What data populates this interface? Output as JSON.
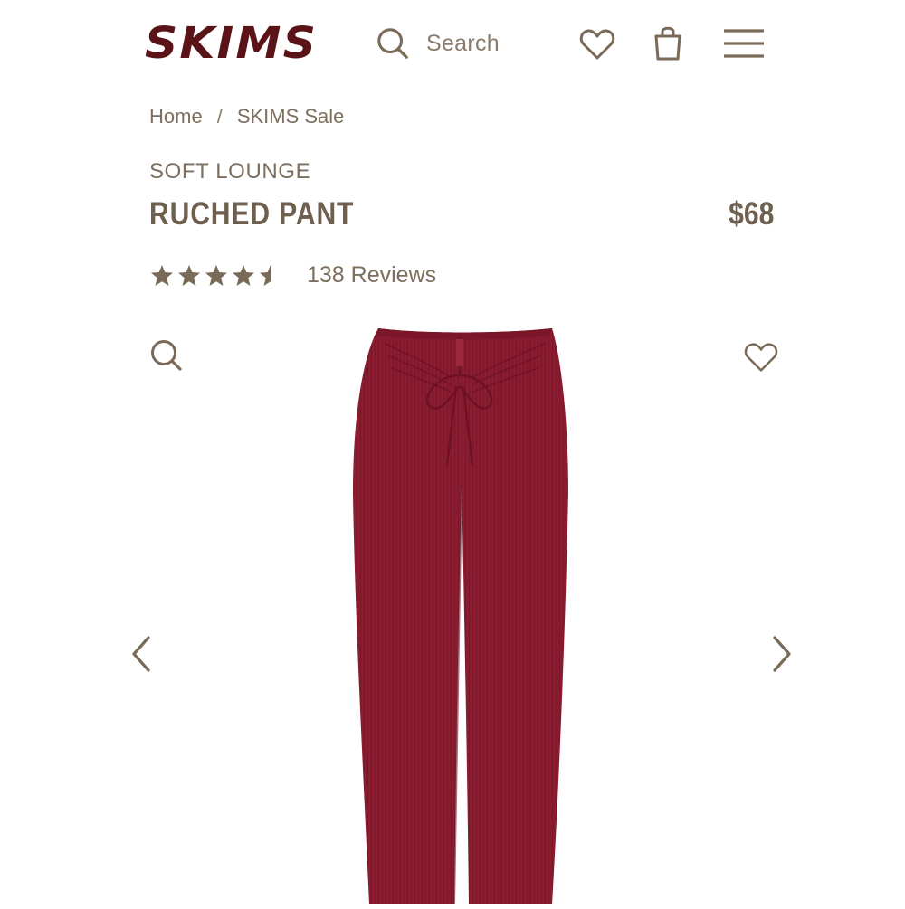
{
  "header": {
    "logo_text": "SKIMS",
    "search_placeholder": "Search",
    "icons": {
      "search": "search-icon",
      "wishlist": "heart-icon",
      "bag": "shopping-bag-icon",
      "menu": "hamburger-menu-icon"
    }
  },
  "breadcrumb": {
    "items": [
      "Home",
      "SKIMS Sale"
    ],
    "separator": "/"
  },
  "product": {
    "collection": "SOFT LOUNGE",
    "name": "RUCHED PANT",
    "price": "$68",
    "rating": 4.5,
    "reviews_label": "138 Reviews",
    "image": "burgundy-ruched-flare-pant"
  },
  "gallery": {
    "icons": {
      "zoom": "magnifier-icon",
      "wishlist": "heart-icon",
      "prev": "chevron-left-icon",
      "next": "chevron-right-icon"
    }
  },
  "colors": {
    "brand": "#5a1418",
    "text": "#7a6a58",
    "product": "#8b1c30"
  }
}
